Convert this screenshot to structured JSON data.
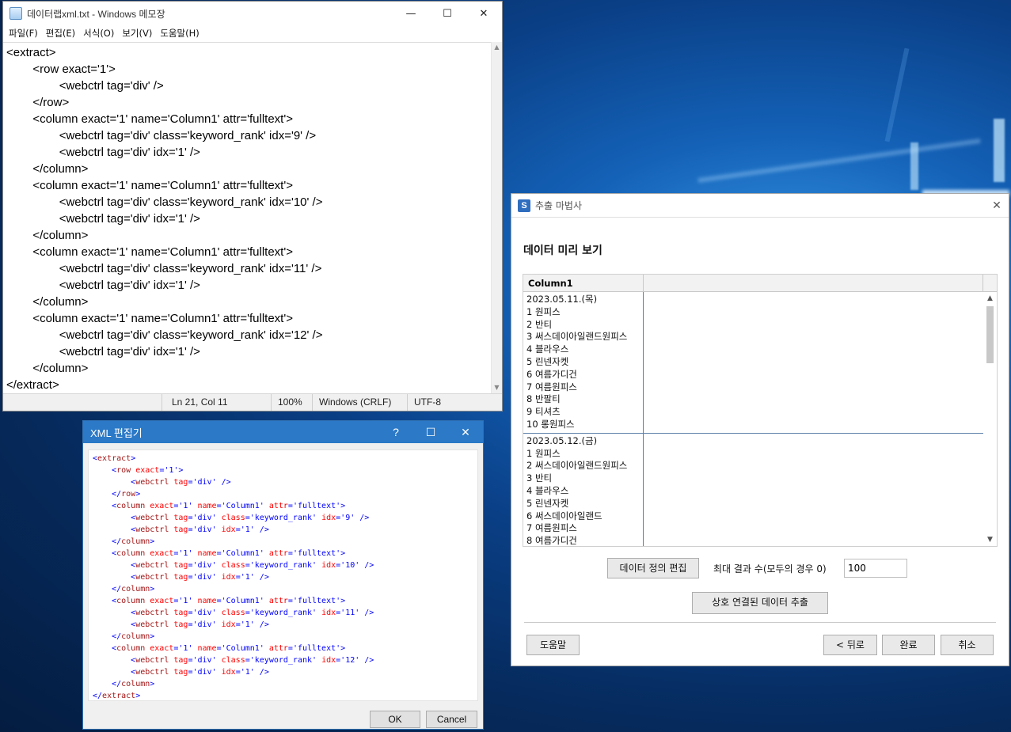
{
  "notepad": {
    "title": "데이터랩xml.txt - Windows 메모장",
    "controls": {
      "minimize": "—",
      "maximize": "☐",
      "close": "✕"
    },
    "menu": [
      "파일(F)",
      "편집(E)",
      "서식(O)",
      "보기(V)",
      "도움말(H)"
    ],
    "content": "<extract>\n\t<row exact='1'>\n\t\t<webctrl tag='div' />\n\t</row>\n\t<column exact='1' name='Column1' attr='fulltext'>\n\t\t<webctrl tag='div' class='keyword_rank' idx='9' />\n\t\t<webctrl tag='div' idx='1' />\n\t</column>\n\t<column exact='1' name='Column1' attr='fulltext'>\n\t\t<webctrl tag='div' class='keyword_rank' idx='10' />\n\t\t<webctrl tag='div' idx='1' />\n\t</column>\n\t<column exact='1' name='Column1' attr='fulltext'>\n\t\t<webctrl tag='div' class='keyword_rank' idx='11' />\n\t\t<webctrl tag='div' idx='1' />\n\t</column>\n\t<column exact='1' name='Column1' attr='fulltext'>\n\t\t<webctrl tag='div' class='keyword_rank' idx='12' />\n\t\t<webctrl tag='div' idx='1' />\n\t</column>\n</extract>",
    "status": {
      "position": "Ln 21, Col 11",
      "zoom": "100%",
      "line_ending": "Windows (CRLF)",
      "encoding": "UTF-8"
    }
  },
  "xml_editor": {
    "title": "XML 편집기",
    "controls": {
      "help": "?",
      "maximize": "☐",
      "close": "✕"
    },
    "lines": [
      {
        "indent": 0,
        "parts": [
          [
            "pu",
            "<"
          ],
          [
            "tg",
            "extract"
          ],
          [
            "pu",
            ">"
          ]
        ]
      },
      {
        "indent": 1,
        "parts": [
          [
            "pu",
            "<"
          ],
          [
            "tg",
            "row"
          ],
          [
            "at",
            " exact"
          ],
          [
            "pu",
            "="
          ],
          [
            "av",
            "'1'"
          ],
          [
            "pu",
            ">"
          ]
        ]
      },
      {
        "indent": 2,
        "parts": [
          [
            "pu",
            "<"
          ],
          [
            "tg",
            "webctrl"
          ],
          [
            "at",
            " tag"
          ],
          [
            "pu",
            "="
          ],
          [
            "av",
            "'div'"
          ],
          [
            "pu",
            " />"
          ]
        ]
      },
      {
        "indent": 1,
        "parts": [
          [
            "pu",
            "</"
          ],
          [
            "tg",
            "row"
          ],
          [
            "pu",
            ">"
          ]
        ]
      },
      {
        "indent": 1,
        "parts": [
          [
            "pu",
            "<"
          ],
          [
            "tg",
            "column"
          ],
          [
            "at",
            " exact"
          ],
          [
            "pu",
            "="
          ],
          [
            "av",
            "'1'"
          ],
          [
            "at",
            " name"
          ],
          [
            "pu",
            "="
          ],
          [
            "av",
            "'Column1'"
          ],
          [
            "at",
            " attr"
          ],
          [
            "pu",
            "="
          ],
          [
            "av",
            "'fulltext'"
          ],
          [
            "pu",
            ">"
          ]
        ]
      },
      {
        "indent": 2,
        "parts": [
          [
            "pu",
            "<"
          ],
          [
            "tg",
            "webctrl"
          ],
          [
            "at",
            " tag"
          ],
          [
            "pu",
            "="
          ],
          [
            "av",
            "'div'"
          ],
          [
            "at",
            " class"
          ],
          [
            "pu",
            "="
          ],
          [
            "av",
            "'keyword_rank'"
          ],
          [
            "at",
            " idx"
          ],
          [
            "pu",
            "="
          ],
          [
            "av",
            "'9'"
          ],
          [
            "pu",
            " />"
          ]
        ]
      },
      {
        "indent": 2,
        "parts": [
          [
            "pu",
            "<"
          ],
          [
            "tg",
            "webctrl"
          ],
          [
            "at",
            " tag"
          ],
          [
            "pu",
            "="
          ],
          [
            "av",
            "'div'"
          ],
          [
            "at",
            " idx"
          ],
          [
            "pu",
            "="
          ],
          [
            "av",
            "'1'"
          ],
          [
            "pu",
            " />"
          ]
        ]
      },
      {
        "indent": 1,
        "parts": [
          [
            "pu",
            "</"
          ],
          [
            "tg",
            "column"
          ],
          [
            "pu",
            ">"
          ]
        ]
      },
      {
        "indent": 1,
        "parts": [
          [
            "pu",
            "<"
          ],
          [
            "tg",
            "column"
          ],
          [
            "at",
            " exact"
          ],
          [
            "pu",
            "="
          ],
          [
            "av",
            "'1'"
          ],
          [
            "at",
            " name"
          ],
          [
            "pu",
            "="
          ],
          [
            "av",
            "'Column1'"
          ],
          [
            "at",
            " attr"
          ],
          [
            "pu",
            "="
          ],
          [
            "av",
            "'fulltext'"
          ],
          [
            "pu",
            ">"
          ]
        ]
      },
      {
        "indent": 2,
        "parts": [
          [
            "pu",
            "<"
          ],
          [
            "tg",
            "webctrl"
          ],
          [
            "at",
            " tag"
          ],
          [
            "pu",
            "="
          ],
          [
            "av",
            "'div'"
          ],
          [
            "at",
            " class"
          ],
          [
            "pu",
            "="
          ],
          [
            "av",
            "'keyword_rank'"
          ],
          [
            "at",
            " idx"
          ],
          [
            "pu",
            "="
          ],
          [
            "av",
            "'10'"
          ],
          [
            "pu",
            " />"
          ]
        ]
      },
      {
        "indent": 2,
        "parts": [
          [
            "pu",
            "<"
          ],
          [
            "tg",
            "webctrl"
          ],
          [
            "at",
            " tag"
          ],
          [
            "pu",
            "="
          ],
          [
            "av",
            "'div'"
          ],
          [
            "at",
            " idx"
          ],
          [
            "pu",
            "="
          ],
          [
            "av",
            "'1'"
          ],
          [
            "pu",
            " />"
          ]
        ]
      },
      {
        "indent": 1,
        "parts": [
          [
            "pu",
            "</"
          ],
          [
            "tg",
            "column"
          ],
          [
            "pu",
            ">"
          ]
        ]
      },
      {
        "indent": 1,
        "parts": [
          [
            "pu",
            "<"
          ],
          [
            "tg",
            "column"
          ],
          [
            "at",
            " exact"
          ],
          [
            "pu",
            "="
          ],
          [
            "av",
            "'1'"
          ],
          [
            "at",
            " name"
          ],
          [
            "pu",
            "="
          ],
          [
            "av",
            "'Column1'"
          ],
          [
            "at",
            " attr"
          ],
          [
            "pu",
            "="
          ],
          [
            "av",
            "'fulltext'"
          ],
          [
            "pu",
            ">"
          ]
        ]
      },
      {
        "indent": 2,
        "parts": [
          [
            "pu",
            "<"
          ],
          [
            "tg",
            "webctrl"
          ],
          [
            "at",
            " tag"
          ],
          [
            "pu",
            "="
          ],
          [
            "av",
            "'div'"
          ],
          [
            "at",
            " class"
          ],
          [
            "pu",
            "="
          ],
          [
            "av",
            "'keyword_rank'"
          ],
          [
            "at",
            " idx"
          ],
          [
            "pu",
            "="
          ],
          [
            "av",
            "'11'"
          ],
          [
            "pu",
            " />"
          ]
        ]
      },
      {
        "indent": 2,
        "parts": [
          [
            "pu",
            "<"
          ],
          [
            "tg",
            "webctrl"
          ],
          [
            "at",
            " tag"
          ],
          [
            "pu",
            "="
          ],
          [
            "av",
            "'div'"
          ],
          [
            "at",
            " idx"
          ],
          [
            "pu",
            "="
          ],
          [
            "av",
            "'1'"
          ],
          [
            "pu",
            " />"
          ]
        ]
      },
      {
        "indent": 1,
        "parts": [
          [
            "pu",
            "</"
          ],
          [
            "tg",
            "column"
          ],
          [
            "pu",
            ">"
          ]
        ]
      },
      {
        "indent": 1,
        "parts": [
          [
            "pu",
            "<"
          ],
          [
            "tg",
            "column"
          ],
          [
            "at",
            " exact"
          ],
          [
            "pu",
            "="
          ],
          [
            "av",
            "'1'"
          ],
          [
            "at",
            " name"
          ],
          [
            "pu",
            "="
          ],
          [
            "av",
            "'Column1'"
          ],
          [
            "at",
            " attr"
          ],
          [
            "pu",
            "="
          ],
          [
            "av",
            "'fulltext'"
          ],
          [
            "pu",
            ">"
          ]
        ]
      },
      {
        "indent": 2,
        "parts": [
          [
            "pu",
            "<"
          ],
          [
            "tg",
            "webctrl"
          ],
          [
            "at",
            " tag"
          ],
          [
            "pu",
            "="
          ],
          [
            "av",
            "'div'"
          ],
          [
            "at",
            " class"
          ],
          [
            "pu",
            "="
          ],
          [
            "av",
            "'keyword_rank'"
          ],
          [
            "at",
            " idx"
          ],
          [
            "pu",
            "="
          ],
          [
            "av",
            "'12'"
          ],
          [
            "pu",
            " />"
          ]
        ]
      },
      {
        "indent": 2,
        "parts": [
          [
            "pu",
            "<"
          ],
          [
            "tg",
            "webctrl"
          ],
          [
            "at",
            " tag"
          ],
          [
            "pu",
            "="
          ],
          [
            "av",
            "'div'"
          ],
          [
            "at",
            " idx"
          ],
          [
            "pu",
            "="
          ],
          [
            "av",
            "'1'"
          ],
          [
            "pu",
            " />"
          ]
        ]
      },
      {
        "indent": 1,
        "parts": [
          [
            "pu",
            "</"
          ],
          [
            "tg",
            "column"
          ],
          [
            "pu",
            ">"
          ]
        ]
      },
      {
        "indent": 0,
        "parts": [
          [
            "pu",
            "</"
          ],
          [
            "tg",
            "extract"
          ],
          [
            "pu",
            ">"
          ]
        ]
      }
    ],
    "ok_label": "OK",
    "cancel_label": "Cancel"
  },
  "wizard": {
    "logo": "S",
    "title": "추출 마법사",
    "close": "✕",
    "heading": "데이터 미리 보기",
    "column_header": "Column1",
    "rows": [
      [
        "2023.05.11.(목)",
        "1 원피스",
        "2 반티",
        "3 써스데이아일랜드원피스",
        "4 블라우스",
        "5 린넨자켓",
        "6 여름가디건",
        "7 여름원피스",
        "8 반팔티",
        "9 티셔츠",
        "10 롱원피스"
      ],
      [
        "2023.05.12.(금)",
        "1 원피스",
        "2 써스데이아일랜드원피스",
        "3 반티",
        "4 블라우스",
        "5 린넨자켓",
        "6 써스데이아일랜드",
        "7 여름원피스",
        "8 여름가디건"
      ]
    ],
    "scroll_up": "▲",
    "scroll_down": "▼",
    "edit_definition_label": "데이터 정의 편집",
    "max_results_label": "최대 결과 수(모두의 경우 0)",
    "max_results_value": "100",
    "linked_extract_label": "상호 연결된 데이터 추출",
    "help_label": "도움말",
    "back_label": "< 뒤로",
    "finish_label": "완료",
    "cancel_label": "취소"
  }
}
